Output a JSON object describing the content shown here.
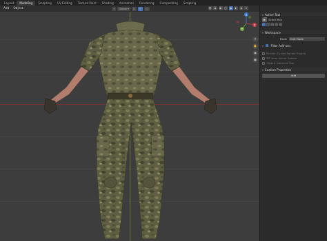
{
  "workspace_tabs": [
    "Layout",
    "Modeling",
    "Sculpting",
    "UV Editing",
    "Texture Paint",
    "Shading",
    "Animation",
    "Rendering",
    "Compositing",
    "Scripting"
  ],
  "active_tab_index": 1,
  "viewport_header": {
    "menus": [
      "Add",
      "Object"
    ],
    "transform_orientation": "Global"
  },
  "gizmo": {
    "x_label": "X",
    "y_label": "Y",
    "z_label": "Z"
  },
  "sidebar": {
    "active_tool_title": "Active Tool",
    "active_tool_name": "Select Box",
    "workspace_title": "Workspace",
    "mode_label": "Mode",
    "mode_value": "Edit Mode",
    "filter_addons_title": "Filter Add-ons",
    "addons": [
      "Render: Cycles Render Engine",
      "3D View: Armor Toolbar",
      "Object: Garment Tool"
    ],
    "custom_properties_title": "Custom Properties",
    "add_label": "Add"
  },
  "colors": {
    "accent": "#4772b3",
    "axis_x": "#7a3232",
    "axis_y": "#7a8a3a",
    "gizmo_x": "#c83c48",
    "gizmo_y": "#6fa83a",
    "gizmo_z": "#3c7ed6",
    "camo_dark": "#4a4a32",
    "camo_light": "#8a8a62"
  }
}
